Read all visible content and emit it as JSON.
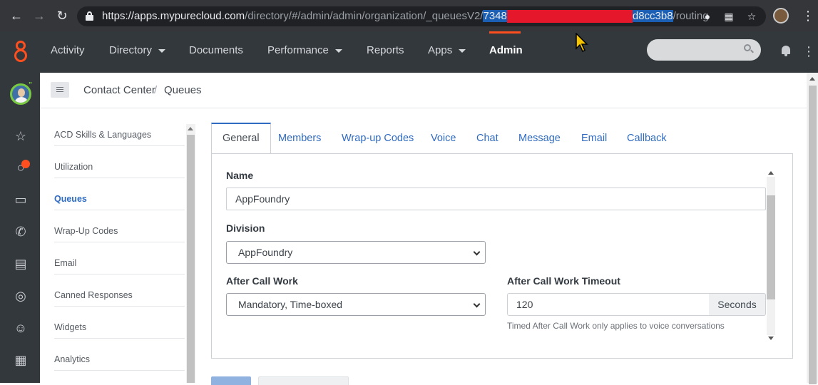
{
  "browser": {
    "url_host": "https://apps.mypurecloud.com",
    "url_path": "/directory/#/admin/admin/organization/_queuesV2/",
    "url_selected_start": "7348",
    "url_selected_end": "d8cc3b8",
    "url_suffix": "/routing"
  },
  "colors": {
    "accent": "#ff4f1f",
    "link": "#2f6bc1",
    "header_bg": "#33383d",
    "presence": "#7ac943",
    "redaction": "#e5172a"
  },
  "header": {
    "nav": [
      {
        "label": "Activity",
        "dropdown": false
      },
      {
        "label": "Directory",
        "dropdown": true
      },
      {
        "label": "Documents",
        "dropdown": false
      },
      {
        "label": "Performance",
        "dropdown": true
      },
      {
        "label": "Reports",
        "dropdown": false
      },
      {
        "label": "Apps",
        "dropdown": true
      },
      {
        "label": "Admin",
        "dropdown": false,
        "active": true
      }
    ]
  },
  "rail": {
    "badge": "”",
    "icons": [
      "star-icon",
      "chat-icon",
      "video-icon",
      "phone-icon",
      "inbox-icon",
      "lifebuoy-icon",
      "voice-user-icon",
      "apps-grid-icon"
    ]
  },
  "breadcrumb": {
    "items": [
      "Contact Center",
      "Queues"
    ],
    "separator": "/"
  },
  "side_menu": {
    "items": [
      "ACD Skills & Languages",
      "Utilization",
      "Queues",
      "Wrap-Up Codes",
      "Email",
      "Canned Responses",
      "Widgets",
      "Analytics"
    ],
    "active": "Queues"
  },
  "tabs": [
    "General",
    "Members",
    "Wrap-up Codes",
    "Voice",
    "Chat",
    "Message",
    "Email",
    "Callback"
  ],
  "form": {
    "name_label": "Name",
    "name_value": "AppFoundry",
    "division_label": "Division",
    "division_value": "AppFoundry",
    "acw_label": "After Call Work",
    "acw_value": "Mandatory, Time-boxed",
    "acw_timeout_label": "After Call Work Timeout",
    "acw_timeout_value": "120",
    "acw_timeout_unit": "Seconds",
    "acw_timeout_help": "Timed After Call Work only applies to voice conversations"
  }
}
